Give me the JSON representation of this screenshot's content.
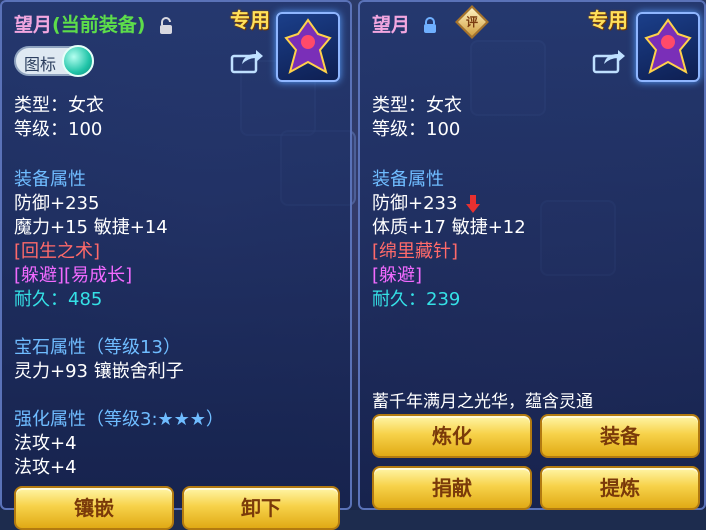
{
  "left": {
    "name": "望月",
    "equip_tag": "(当前装备)",
    "special_label": "专用",
    "icon_toggle_label": "图标",
    "type_line": "类型：女衣",
    "level_line": "等级：100",
    "attr_header": "装备属性",
    "attr_lines": [
      "防御+235",
      "魔力+15 敏捷+14"
    ],
    "effect_line": "[回生之术]",
    "skill_line": "[躲避][易成长]",
    "durability_label": "耐久：",
    "durability_value": "485",
    "gem_header": "宝石属性（等级13）",
    "gem_line": "灵力+93 镶嵌舍利子",
    "enhance_header": "强化属性（等级3:★★★）",
    "enhance_lines": [
      "法攻+4",
      "法攻+4"
    ],
    "buttons": [
      "镶嵌",
      "卸下"
    ]
  },
  "right": {
    "name": "望月",
    "eval_label": "评",
    "special_label": "专用",
    "type_line": "类型：女衣",
    "level_line": "等级：100",
    "attr_header": "装备属性",
    "attr_lines": [
      "防御+233",
      "体质+17 敏捷+12"
    ],
    "effect_line": "[绵里藏针]",
    "skill_line": "[躲避]",
    "durability_label": "耐久：",
    "durability_value": "239",
    "description": "蓄千年满月之光华，蕴含灵通",
    "buttons": [
      "炼化",
      "装备",
      "捐献",
      "提炼"
    ]
  },
  "icons": [
    "lock-open-icon",
    "lock-icon",
    "share-icon",
    "down-arrow-icon",
    "portrait-icon"
  ]
}
